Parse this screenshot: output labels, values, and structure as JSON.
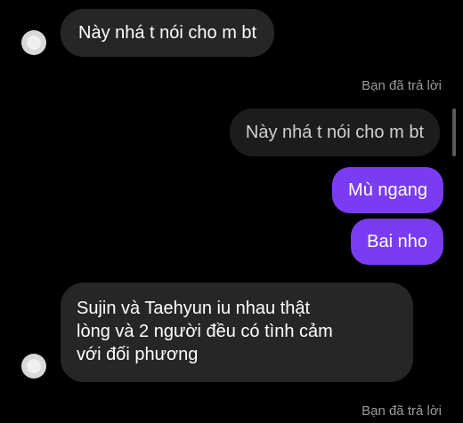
{
  "colors": {
    "background": "#000000",
    "incoming_bubble": "#262626",
    "quoted_bubble": "#1c1c1c",
    "outgoing_bubble": "#7a3cf2",
    "meta_text": "#9a9a9a"
  },
  "messages": [
    {
      "type": "incoming",
      "text": "Này nhá t nói cho m bt",
      "avatar_icon": "default-avatar-icon"
    },
    {
      "type": "reply_label",
      "text": "Bạn đã trả lời"
    },
    {
      "type": "quoted",
      "text": "Này nhá t nói cho m bt"
    },
    {
      "type": "outgoing",
      "text": "Mù ngang"
    },
    {
      "type": "outgoing",
      "text": "Bai nho"
    },
    {
      "type": "incoming",
      "lines": [
        "Sujin và Taehyun iu nhau thật",
        "lòng và 2 người đều có tình cảm",
        "với đối phương"
      ],
      "avatar_icon": "default-avatar-icon"
    },
    {
      "type": "reply_label",
      "text": "Bạn đã trả lời"
    }
  ]
}
